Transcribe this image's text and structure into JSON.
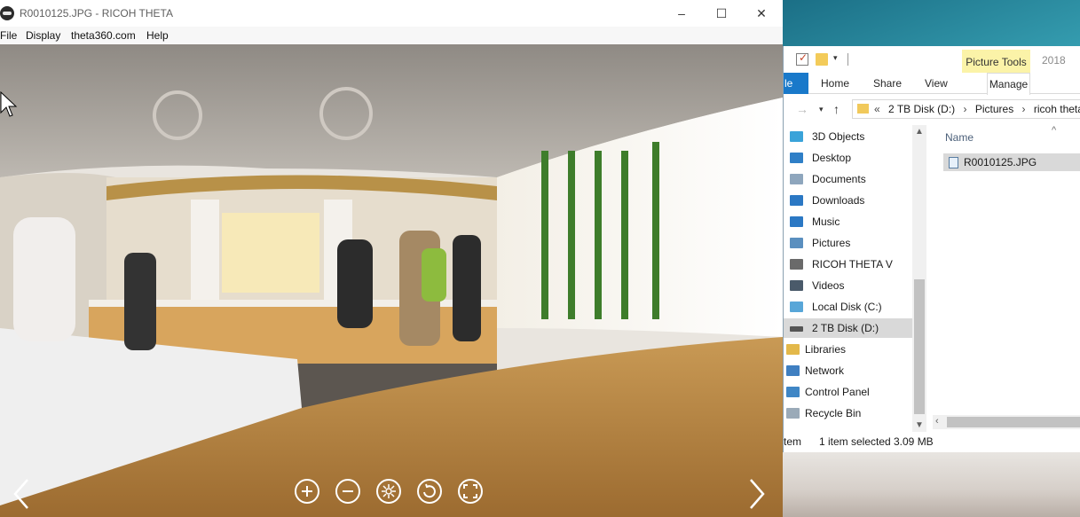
{
  "viewer_window": {
    "title": "R0010125.JPG - RICOH THETA",
    "menu": [
      "File",
      "Display",
      "theta360.com",
      "Help"
    ],
    "window_controls": {
      "minimize": "–",
      "maximize": "☐",
      "close": "✕"
    },
    "controls": {
      "prev": "chevron-left-icon",
      "next": "chevron-right-icon",
      "toolbar": [
        "zoom-in-icon",
        "zoom-out-icon",
        "spin-icon",
        "rotate-icon",
        "fullscreen-icon"
      ]
    }
  },
  "explorer": {
    "contextual_tab": "Picture Tools",
    "contextual_year": "2018",
    "ribbon_tabs": {
      "file": "le",
      "home": "Home",
      "share": "Share",
      "view": "View",
      "manage": "Manage"
    },
    "address_crumbs": [
      "«",
      "2 TB Disk (D:)",
      "›",
      "Pictures",
      "›",
      "ricoh theta"
    ],
    "nav_items": [
      {
        "label": "3D Objects",
        "icon": "3d-objects-icon",
        "color": "#3aa3d9"
      },
      {
        "label": "Desktop",
        "icon": "desktop-icon",
        "color": "#2f7fc7"
      },
      {
        "label": "Documents",
        "icon": "documents-icon",
        "color": "#8ea6bd"
      },
      {
        "label": "Downloads",
        "icon": "downloads-icon",
        "color": "#2b78c4"
      },
      {
        "label": "Music",
        "icon": "music-icon",
        "color": "#2b78c4"
      },
      {
        "label": "Pictures",
        "icon": "pictures-icon",
        "color": "#5a8fbf"
      },
      {
        "label": "RICOH THETA V",
        "icon": "camera-icon",
        "color": "#6a6a6a"
      },
      {
        "label": "Videos",
        "icon": "videos-icon",
        "color": "#4a5a6a"
      },
      {
        "label": "Local Disk (C:)",
        "icon": "drive-icon",
        "color": "#58a6d8"
      },
      {
        "label": "2 TB Disk (D:)",
        "icon": "drive-icon",
        "color": "#555555"
      },
      {
        "label": "Libraries",
        "icon": "libraries-icon",
        "color": "#e3b84a"
      },
      {
        "label": "Network",
        "icon": "network-icon",
        "color": "#3f7fc1"
      },
      {
        "label": "Control Panel",
        "icon": "control-panel-icon",
        "color": "#3f86c5"
      },
      {
        "label": "Recycle Bin",
        "icon": "recycle-bin-icon",
        "color": "#9aaab8"
      }
    ],
    "selected_nav": "2 TB Disk (D:)",
    "column_header": "Name",
    "files": [
      {
        "name": "R0010125.JPG",
        "icon": "image-file-icon"
      }
    ],
    "status": {
      "items": "tem",
      "selected": "1 item selected",
      "size": "3.09 MB"
    }
  }
}
